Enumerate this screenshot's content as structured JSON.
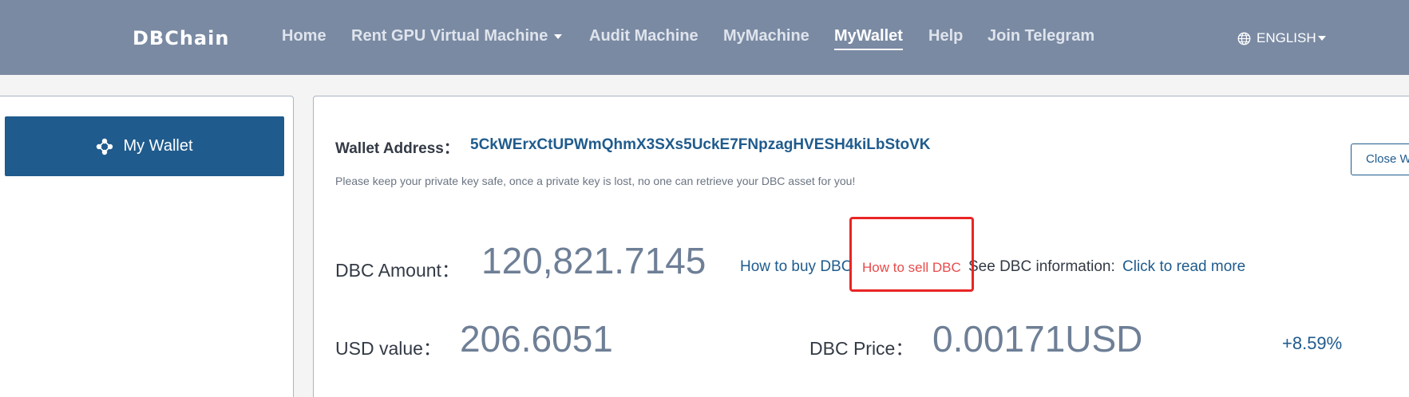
{
  "header": {
    "logo": "DBChain",
    "nav": [
      {
        "label": "Home"
      },
      {
        "label": "Rent GPU Virtual Machine"
      },
      {
        "label": "Audit Machine"
      },
      {
        "label": "MyMachine"
      },
      {
        "label": "MyWallet",
        "active": true
      },
      {
        "label": "Help"
      },
      {
        "label": "Join Telegram"
      }
    ],
    "language": "ENGLISH"
  },
  "sidebar": {
    "wallet_button": "My Wallet"
  },
  "wallet": {
    "address_label": "Wallet Address：",
    "address": "5CkWErxCtUPWmQhmX3SXs5UckE7FNpzagHVESH4kiLbStoVK",
    "warning": "Please keep your private key safe, once a private key is lost, no one can retrieve your DBC asset for you!",
    "close_button": "Close Wallet",
    "dbc_amount_label": "DBC Amount：",
    "dbc_amount": "120,821.7145",
    "how_to_buy": "How to buy DBC",
    "how_to_sell": "How to sell DBC",
    "see_info": "See DBC information:",
    "read_more": "Click to read more",
    "usd_value_label": "USD value：",
    "usd_value": "206.6051",
    "dbc_price_label": "DBC Price：",
    "dbc_price": "0.00171USD",
    "price_change": "+8.59%"
  },
  "colors": {
    "header_bg": "#7a8aa3",
    "accent": "#1f5b8d",
    "highlight": "#ea2525",
    "sell_link": "#e84b4b"
  }
}
